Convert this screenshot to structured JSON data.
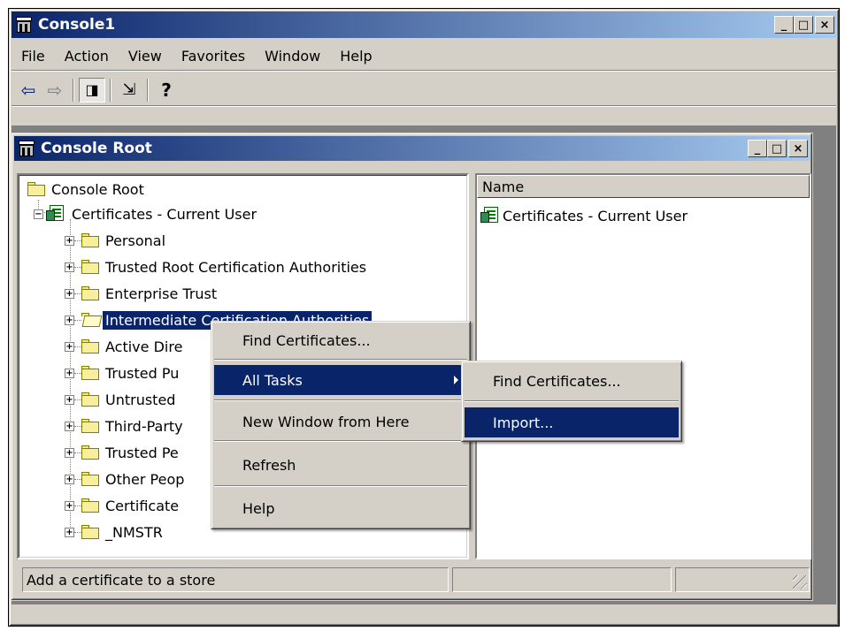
{
  "window": {
    "title": "Console1",
    "minimize": "_",
    "maximize": "□",
    "close": "×"
  },
  "menubar": [
    "File",
    "Action",
    "View",
    "Favorites",
    "Window",
    "Help"
  ],
  "toolbar": {
    "back": "⇦",
    "forward": "⇨",
    "show_hide_tree": "◨",
    "export_list": "⇲",
    "help": "?"
  },
  "child_window": {
    "title": "Console Root"
  },
  "tree": {
    "root": "Console Root",
    "certificates": "Certificates - Current User",
    "stores": [
      "Personal",
      "Trusted Root Certification Authorities",
      "Enterprise Trust",
      "Intermediate Certification Authorities",
      "Active Dire",
      "Trusted Pu",
      "Untrusted",
      "Third-Party",
      "Trusted Pe",
      "Other Peop",
      "Certificate",
      "_NMSTR"
    ],
    "selected_index": 3
  },
  "list": {
    "header": "Name",
    "items": [
      "Certificates - Current User"
    ]
  },
  "context_menu": {
    "items": [
      "Find Certificates...",
      "All Tasks",
      "New Window from Here",
      "Refresh",
      "Help"
    ],
    "highlighted": "All Tasks"
  },
  "submenu": {
    "items": [
      "Find Certificates...",
      "Import..."
    ],
    "highlighted": "Import..."
  },
  "statusbar": {
    "text": "Add a certificate to a store"
  },
  "colors": {
    "title_gradient_start": "#0a246a",
    "title_gradient_end": "#a6caf0",
    "face": "#d4d0c8",
    "highlight": "#0a246a"
  }
}
